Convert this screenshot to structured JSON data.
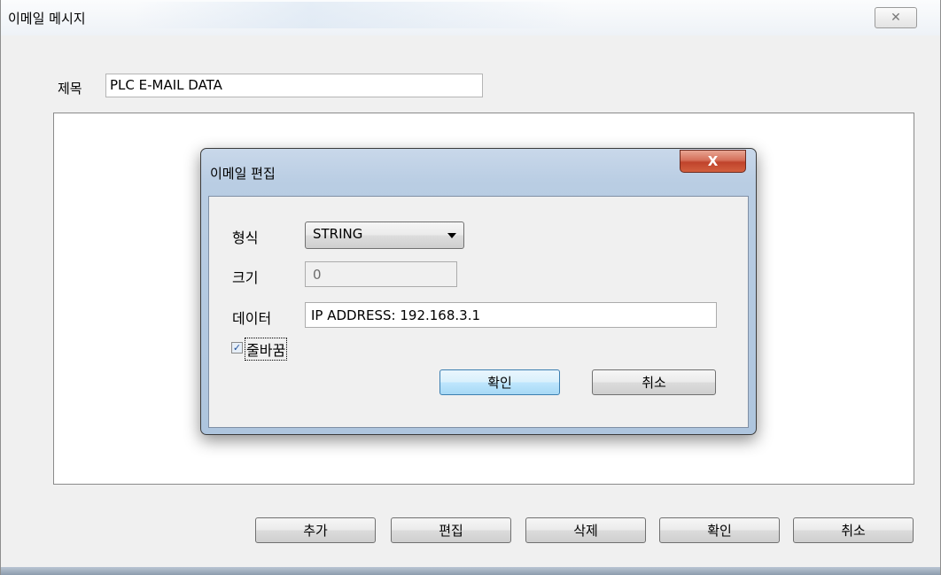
{
  "window": {
    "title": "이메일 메시지",
    "close_glyph": "✕"
  },
  "subject": {
    "label": "제목",
    "value": "PLC E-MAIL DATA"
  },
  "bottom_buttons": {
    "add": "추가",
    "edit": "편집",
    "delete": "삭제",
    "ok": "확인",
    "cancel": "취소"
  },
  "dialog": {
    "title": "이메일 편집",
    "close_glyph": "X",
    "format_label": "형식",
    "format_value": "STRING",
    "size_label": "크기",
    "size_value": "0",
    "data_label": "데이터",
    "data_value": "IP ADDRESS: 192.168.3.1",
    "wrap_label": "줄바꿈",
    "wrap_checked": true,
    "ok": "확인",
    "cancel": "취소"
  }
}
